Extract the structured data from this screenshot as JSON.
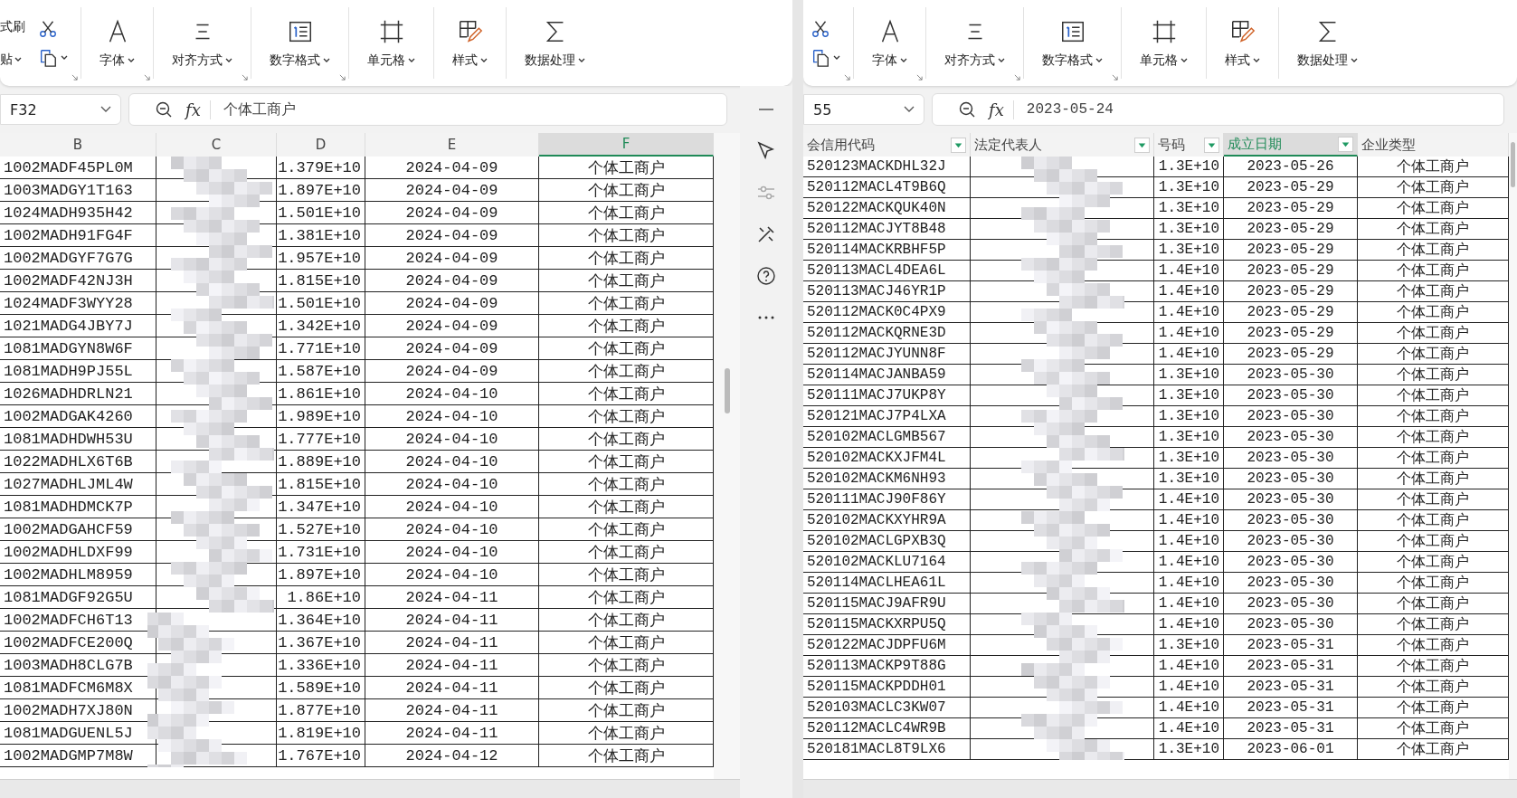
{
  "panes": [
    {
      "ribbon": {
        "clipboard": {
          "labels": [
            "式刷",
            "贴"
          ],
          "launcher": true
        },
        "groups": [
          {
            "kind": "font",
            "label": "字体",
            "launcher": true
          },
          {
            "kind": "align",
            "label": "对齐方式",
            "launcher": true
          },
          {
            "kind": "number",
            "label": "数字格式",
            "launcher": true
          },
          {
            "kind": "cell",
            "label": "单元格",
            "launcher": false
          },
          {
            "kind": "style",
            "label": "样式",
            "launcher": false
          },
          {
            "kind": "data",
            "label": "数据处理",
            "launcher": false
          }
        ]
      },
      "name_box": "F32",
      "formula_label": "fx",
      "formula": "个体工商户",
      "columns": [
        {
          "label": "B",
          "selected": false,
          "filter": false,
          "kind": "text"
        },
        {
          "label": "C",
          "selected": false,
          "filter": false,
          "kind": "blurred"
        },
        {
          "label": "D",
          "selected": false,
          "filter": false,
          "kind": "text"
        },
        {
          "label": "E",
          "selected": false,
          "filter": false,
          "kind": "text"
        },
        {
          "label": "F",
          "selected": true,
          "filter": false,
          "kind": "text"
        }
      ],
      "rows": [
        [
          "1002MADF45PL0M",
          "",
          "1.379E+10",
          "2024-04-09",
          "个体工商户"
        ],
        [
          "1003MADGY1T163",
          "",
          "1.897E+10",
          "2024-04-09",
          "个体工商户"
        ],
        [
          "1024MADH935H42",
          "",
          "1.501E+10",
          "2024-04-09",
          "个体工商户"
        ],
        [
          "1002MADH91FG4F",
          "",
          "1.381E+10",
          "2024-04-09",
          "个体工商户"
        ],
        [
          "1002MADGYF7G7G",
          "",
          "1.957E+10",
          "2024-04-09",
          "个体工商户"
        ],
        [
          "1002MADF42NJ3H",
          "",
          "1.815E+10",
          "2024-04-09",
          "个体工商户"
        ],
        [
          "1024MADF3WYY28",
          "",
          "1.501E+10",
          "2024-04-09",
          "个体工商户"
        ],
        [
          "1021MADG4JBY7J",
          "",
          "1.342E+10",
          "2024-04-09",
          "个体工商户"
        ],
        [
          "1081MADGYN8W6F",
          "",
          "1.771E+10",
          "2024-04-09",
          "个体工商户"
        ],
        [
          "1081MADH9PJ55L",
          "",
          "1.587E+10",
          "2024-04-09",
          "个体工商户"
        ],
        [
          "1026MADHDRLN21",
          "",
          "1.861E+10",
          "2024-04-10",
          "个体工商户"
        ],
        [
          "1002MADGAK4260",
          "",
          "1.989E+10",
          "2024-04-10",
          "个体工商户"
        ],
        [
          "1081MADHDWH53U",
          "",
          "1.777E+10",
          "2024-04-10",
          "个体工商户"
        ],
        [
          "1022MADHLX6T6B",
          "",
          "1.889E+10",
          "2024-04-10",
          "个体工商户"
        ],
        [
          "1027MADHLJML4W",
          "",
          "1.815E+10",
          "2024-04-10",
          "个体工商户"
        ],
        [
          "1081MADHDMCK7P",
          "",
          "1.347E+10",
          "2024-04-10",
          "个体工商户"
        ],
        [
          "1002MADGAHCF59",
          "",
          "1.527E+10",
          "2024-04-10",
          "个体工商户"
        ],
        [
          "1002MADHLDXF99",
          "",
          "1.731E+10",
          "2024-04-10",
          "个体工商户"
        ],
        [
          "1002MADHLM8959",
          "",
          "1.897E+10",
          "2024-04-10",
          "个体工商户"
        ],
        [
          "1081MADGF92G5U",
          "",
          "1.86E+10",
          "2024-04-11",
          "个体工商户"
        ],
        [
          "1002MADFCH6T13",
          "",
          "1.364E+10",
          "2024-04-11",
          "个体工商户"
        ],
        [
          "1002MADFCE200Q",
          "",
          "1.367E+10",
          "2024-04-11",
          "个体工商户"
        ],
        [
          "1003MADH8CLG7B",
          "",
          "1.336E+10",
          "2024-04-11",
          "个体工商户"
        ],
        [
          "1081MADFCM6M8X",
          "",
          "1.589E+10",
          "2024-04-11",
          "个体工商户"
        ],
        [
          "1002MADH7XJ80N",
          "",
          "1.877E+10",
          "2024-04-11",
          "个体工商户"
        ],
        [
          "1081MADGUENL5J",
          "",
          "1.819E+10",
          "2024-04-11",
          "个体工商户"
        ],
        [
          "1002MADGMP7M8W",
          "",
          "1.767E+10",
          "2024-04-12",
          "个体工商户"
        ]
      ]
    },
    {
      "ribbon": {
        "clipboard": {
          "launcher": true
        },
        "groups": [
          {
            "kind": "font",
            "label": "字体",
            "launcher": true
          },
          {
            "kind": "align",
            "label": "对齐方式",
            "launcher": true
          },
          {
            "kind": "number",
            "label": "数字格式",
            "launcher": true
          },
          {
            "kind": "cell",
            "label": "单元格",
            "launcher": false
          },
          {
            "kind": "style",
            "label": "样式",
            "launcher": false
          },
          {
            "kind": "data",
            "label": "数据处理",
            "launcher": false
          }
        ]
      },
      "name_box": "55",
      "formula_label": "fx",
      "formula": "2023-05-24",
      "columns": [
        {
          "label": "会信用代码",
          "selected": false,
          "filter": true,
          "kind": "text"
        },
        {
          "label": "法定代表人",
          "selected": false,
          "filter": true,
          "kind": "blurred"
        },
        {
          "label": "号码",
          "selected": false,
          "filter": true,
          "kind": "text"
        },
        {
          "label": "成立日期",
          "selected": true,
          "filter": true,
          "kind": "text"
        },
        {
          "label": "企业类型",
          "selected": false,
          "filter": false,
          "kind": "text"
        }
      ],
      "rows": [
        [
          "520123MACKDHL32J",
          "",
          "1.3E+10",
          "2023-05-26",
          "个体工商户"
        ],
        [
          "520112MACL4T9B6Q",
          "",
          "1.3E+10",
          "2023-05-29",
          "个体工商户"
        ],
        [
          "520122MACKQUK40N",
          "",
          "1.3E+10",
          "2023-05-29",
          "个体工商户"
        ],
        [
          "520112MACJYT8B48",
          "",
          "1.3E+10",
          "2023-05-29",
          "个体工商户"
        ],
        [
          "520114MACKRBHF5P",
          "",
          "1.3E+10",
          "2023-05-29",
          "个体工商户"
        ],
        [
          "520113MACL4DEA6L",
          "",
          "1.4E+10",
          "2023-05-29",
          "个体工商户"
        ],
        [
          "520113MACJ46YR1P",
          "",
          "1.4E+10",
          "2023-05-29",
          "个体工商户"
        ],
        [
          "520112MACK0C4PX9",
          "",
          "1.4E+10",
          "2023-05-29",
          "个体工商户"
        ],
        [
          "520112MACKQRNE3D",
          "",
          "1.4E+10",
          "2023-05-29",
          "个体工商户"
        ],
        [
          "520112MACJYUNN8F",
          "",
          "1.4E+10",
          "2023-05-29",
          "个体工商户"
        ],
        [
          "520114MACJANBA59",
          "",
          "1.3E+10",
          "2023-05-30",
          "个体工商户"
        ],
        [
          "520111MACJ7UKP8Y",
          "",
          "1.3E+10",
          "2023-05-30",
          "个体工商户"
        ],
        [
          "520121MACJ7P4LXA",
          "",
          "1.3E+10",
          "2023-05-30",
          "个体工商户"
        ],
        [
          "520102MACLGMB567",
          "",
          "1.3E+10",
          "2023-05-30",
          "个体工商户"
        ],
        [
          "520102MACKXJFM4L",
          "",
          "1.3E+10",
          "2023-05-30",
          "个体工商户"
        ],
        [
          "520102MACKM6NH93",
          "",
          "1.3E+10",
          "2023-05-30",
          "个体工商户"
        ],
        [
          "520111MACJ90F86Y",
          "",
          "1.4E+10",
          "2023-05-30",
          "个体工商户"
        ],
        [
          "520102MACKXYHR9A",
          "",
          "1.4E+10",
          "2023-05-30",
          "个体工商户"
        ],
        [
          "520102MACLGPXB3Q",
          "",
          "1.4E+10",
          "2023-05-30",
          "个体工商户"
        ],
        [
          "520102MACKLU7164",
          "",
          "1.4E+10",
          "2023-05-30",
          "个体工商户"
        ],
        [
          "520114MACLHEA61L",
          "",
          "1.4E+10",
          "2023-05-30",
          "个体工商户"
        ],
        [
          "520115MACJ9AFR9U",
          "",
          "1.4E+10",
          "2023-05-30",
          "个体工商户"
        ],
        [
          "520115MACKXRPU5Q",
          "",
          "1.4E+10",
          "2023-05-30",
          "个体工商户"
        ],
        [
          "520122MACJDPFU6M",
          "",
          "1.3E+10",
          "2023-05-31",
          "个体工商户"
        ],
        [
          "520113MACKP9T88G",
          "",
          "1.4E+10",
          "2023-05-31",
          "个体工商户"
        ],
        [
          "520115MACKPDDH01",
          "",
          "1.4E+10",
          "2023-05-31",
          "个体工商户"
        ],
        [
          "520103MACLC3KW07",
          "",
          "1.4E+10",
          "2023-05-31",
          "个体工商户"
        ],
        [
          "520112MACLC4WR9B",
          "",
          "1.4E+10",
          "2023-05-31",
          "个体工商户"
        ],
        [
          "520181MACL8T9LX6",
          "",
          "1.3E+10",
          "2023-06-01",
          "个体工商户"
        ]
      ]
    }
  ]
}
